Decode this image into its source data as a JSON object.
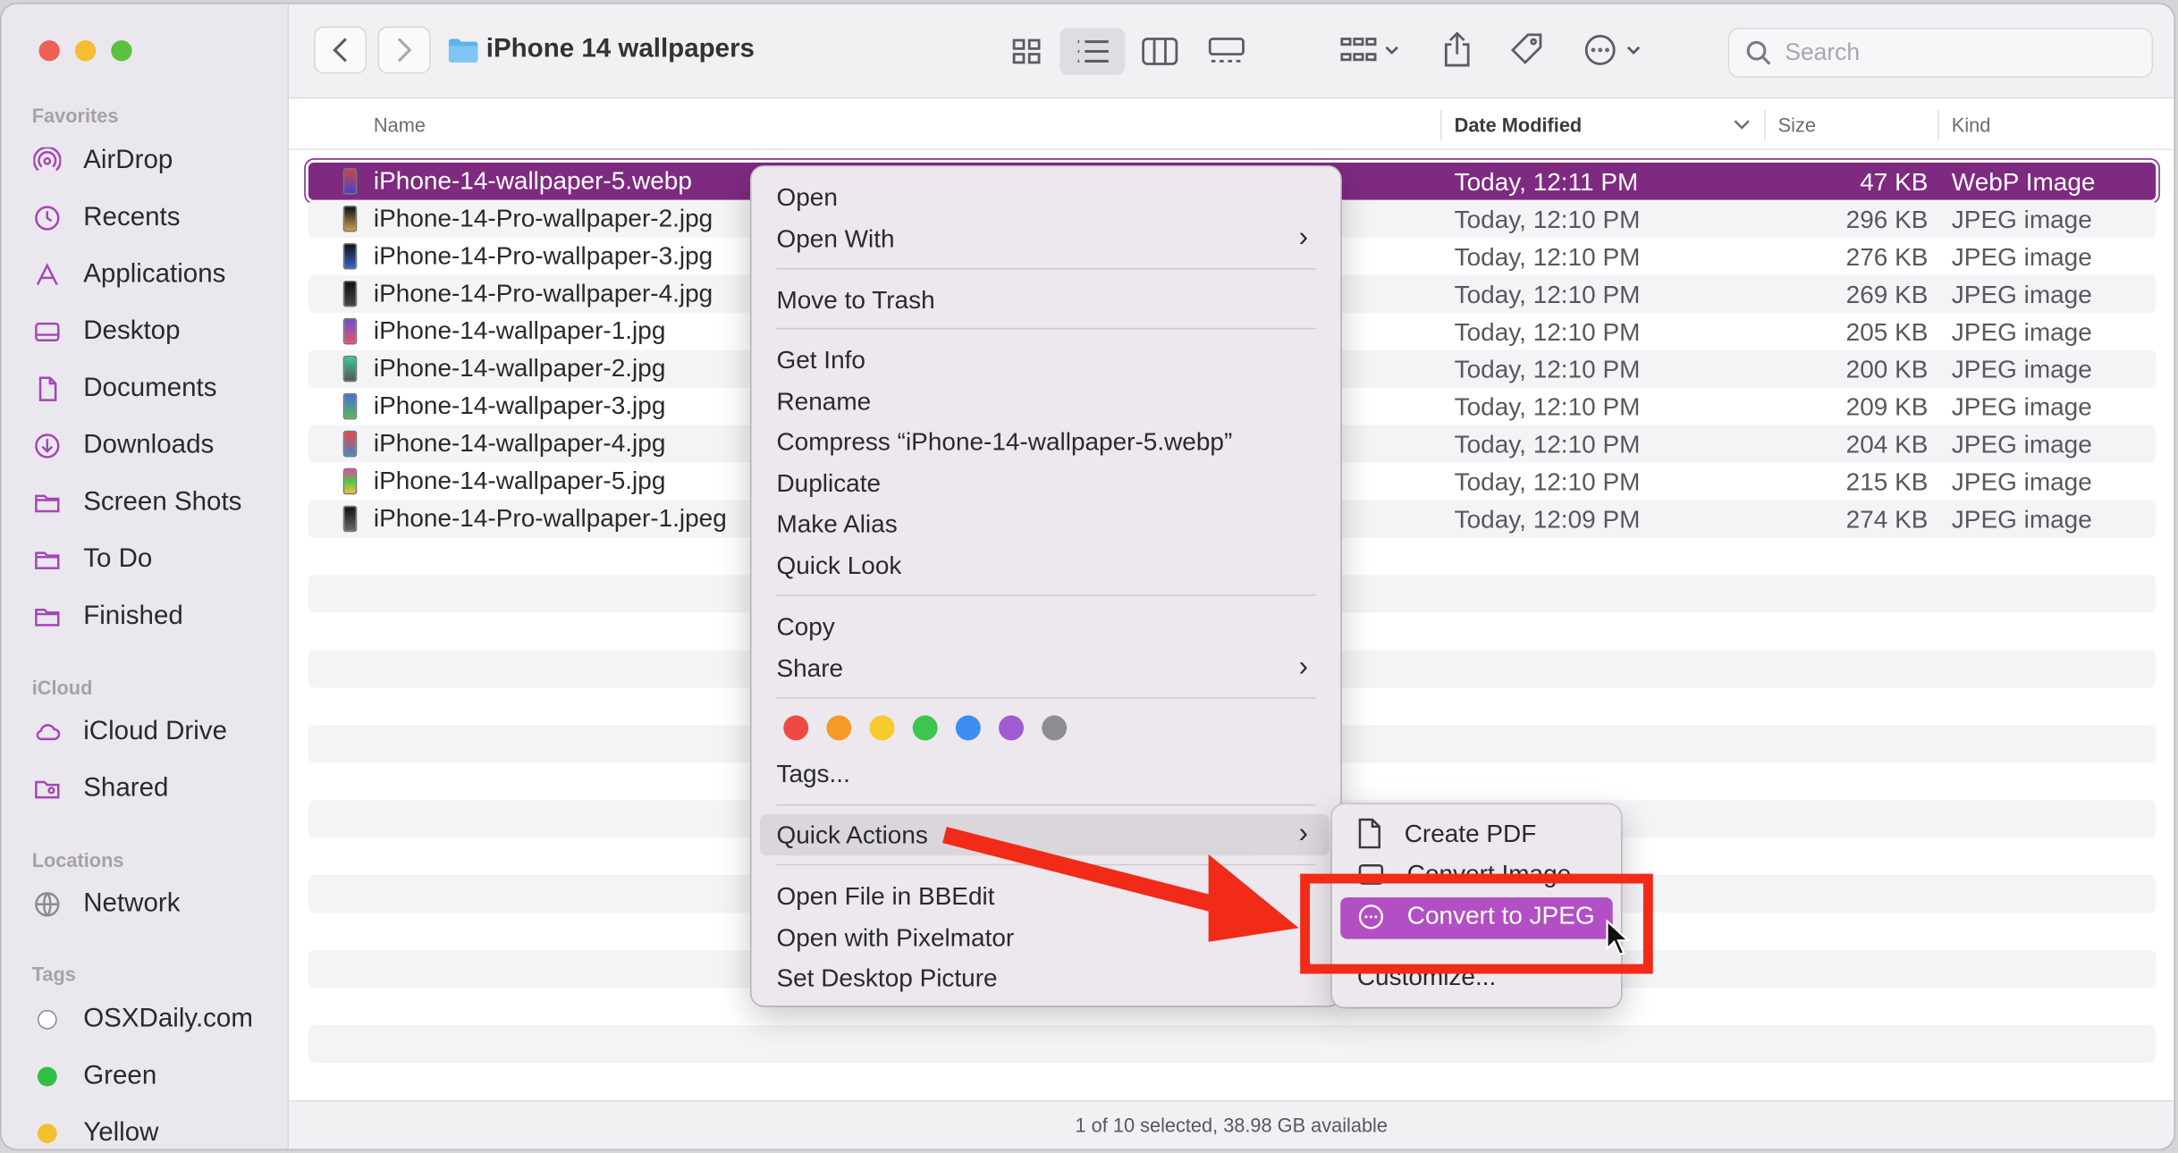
{
  "window": {
    "title": "iPhone 14 wallpapers",
    "search_placeholder": "Search"
  },
  "sidebar": {
    "sections": {
      "favorites": "Favorites",
      "icloud": "iCloud",
      "locations": "Locations",
      "tags": "Tags"
    },
    "favorites": [
      {
        "label": "AirDrop",
        "icon": "airdrop-icon"
      },
      {
        "label": "Recents",
        "icon": "clock-icon"
      },
      {
        "label": "Applications",
        "icon": "applications-icon"
      },
      {
        "label": "Desktop",
        "icon": "desktop-icon"
      },
      {
        "label": "Documents",
        "icon": "document-icon"
      },
      {
        "label": "Downloads",
        "icon": "download-icon"
      },
      {
        "label": "Screen Shots",
        "icon": "folder-icon"
      },
      {
        "label": "To Do",
        "icon": "folder-icon"
      },
      {
        "label": "Finished",
        "icon": "folder-icon"
      }
    ],
    "icloud": [
      {
        "label": "iCloud Drive",
        "icon": "cloud-icon"
      },
      {
        "label": "Shared",
        "icon": "shared-folder-icon"
      }
    ],
    "locations": [
      {
        "label": "Network",
        "icon": "globe-icon"
      }
    ],
    "tags": [
      {
        "label": "OSXDaily.com",
        "color": "#ffffff"
      },
      {
        "label": "Green",
        "color": "#2fbf45"
      },
      {
        "label": "Yellow",
        "color": "#f2c02c"
      }
    ]
  },
  "columns": {
    "name": "Name",
    "date": "Date Modified",
    "size": "Size",
    "kind": "Kind"
  },
  "files": [
    {
      "name": "iPhone-14-wallpaper-5.webp",
      "date": "Today, 12:11 PM",
      "size": "47 KB",
      "kind": "WebP Image",
      "selected": true
    },
    {
      "name": "iPhone-14-Pro-wallpaper-2.jpg",
      "date": "Today, 12:10 PM",
      "size": "296 KB",
      "kind": "JPEG image"
    },
    {
      "name": "iPhone-14-Pro-wallpaper-3.jpg",
      "date": "Today, 12:10 PM",
      "size": "276 KB",
      "kind": "JPEG image"
    },
    {
      "name": "iPhone-14-Pro-wallpaper-4.jpg",
      "date": "Today, 12:10 PM",
      "size": "269 KB",
      "kind": "JPEG image"
    },
    {
      "name": "iPhone-14-wallpaper-1.jpg",
      "date": "Today, 12:10 PM",
      "size": "205 KB",
      "kind": "JPEG image"
    },
    {
      "name": "iPhone-14-wallpaper-2.jpg",
      "date": "Today, 12:10 PM",
      "size": "200 KB",
      "kind": "JPEG image"
    },
    {
      "name": "iPhone-14-wallpaper-3.jpg",
      "date": "Today, 12:10 PM",
      "size": "209 KB",
      "kind": "JPEG image"
    },
    {
      "name": "iPhone-14-wallpaper-4.jpg",
      "date": "Today, 12:10 PM",
      "size": "204 KB",
      "kind": "JPEG image"
    },
    {
      "name": "iPhone-14-wallpaper-5.jpg",
      "date": "Today, 12:10 PM",
      "size": "215 KB",
      "kind": "JPEG image"
    },
    {
      "name": "iPhone-14-Pro-wallpaper-1.jpeg",
      "date": "Today, 12:09 PM",
      "size": "274 KB",
      "kind": "JPEG image"
    }
  ],
  "status": "1 of 10 selected, 38.98 GB available",
  "context_menu": {
    "open": "Open",
    "open_with": "Open With",
    "move_to_trash": "Move to Trash",
    "get_info": "Get Info",
    "rename": "Rename",
    "compress": "Compress “iPhone-14-wallpaper-5.webp”",
    "duplicate": "Duplicate",
    "make_alias": "Make Alias",
    "quick_look": "Quick Look",
    "copy": "Copy",
    "share": "Share",
    "tag_colors": [
      "#ee4a43",
      "#f59a27",
      "#f5ca2b",
      "#3ec54f",
      "#3e8ef1",
      "#a25ad1",
      "#8e8e92"
    ],
    "tags": "Tags...",
    "quick_actions": "Quick Actions",
    "open_bbedit": "Open File in BBEdit",
    "open_pixelmator": "Open with Pixelmator",
    "set_desktop": "Set Desktop Picture"
  },
  "quick_actions_menu": {
    "create_pdf": "Create PDF",
    "convert_image": "Convert Image",
    "convert_jpeg": "Convert to JPEG",
    "customize": "Customize..."
  },
  "colors": {
    "selection": "#7e2a80",
    "submenu_highlight": "#b34fc4",
    "annotation_red": "#f12b17"
  }
}
